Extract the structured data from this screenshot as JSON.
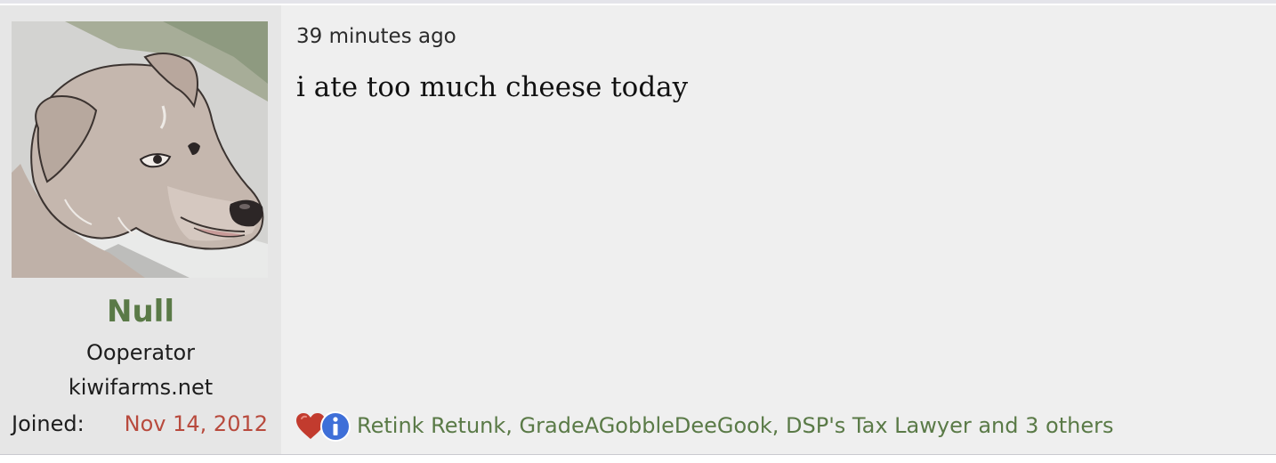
{
  "post": {
    "author": {
      "username": "Null",
      "title": "Ooperator",
      "banner": "kiwifarms.net",
      "joined_label": "Joined:",
      "joined_date": "Nov 14, 2012",
      "avatar_icon": "dog-avatar"
    },
    "timestamp": "39 minutes ago",
    "body": "i ate too much cheese today",
    "reactions": {
      "icons": [
        "heart-icon",
        "info-icon"
      ],
      "users_text": "Retink Retunk, GradeAGobbleDeeGook, DSP's Tax Lawyer and 3 others"
    }
  },
  "colors": {
    "username": "#5a7a47",
    "joined_date": "#b84a3d",
    "reaction_link": "#5a7a47",
    "post_bg": "#efefef",
    "user_col_bg": "#e6e6e6"
  }
}
